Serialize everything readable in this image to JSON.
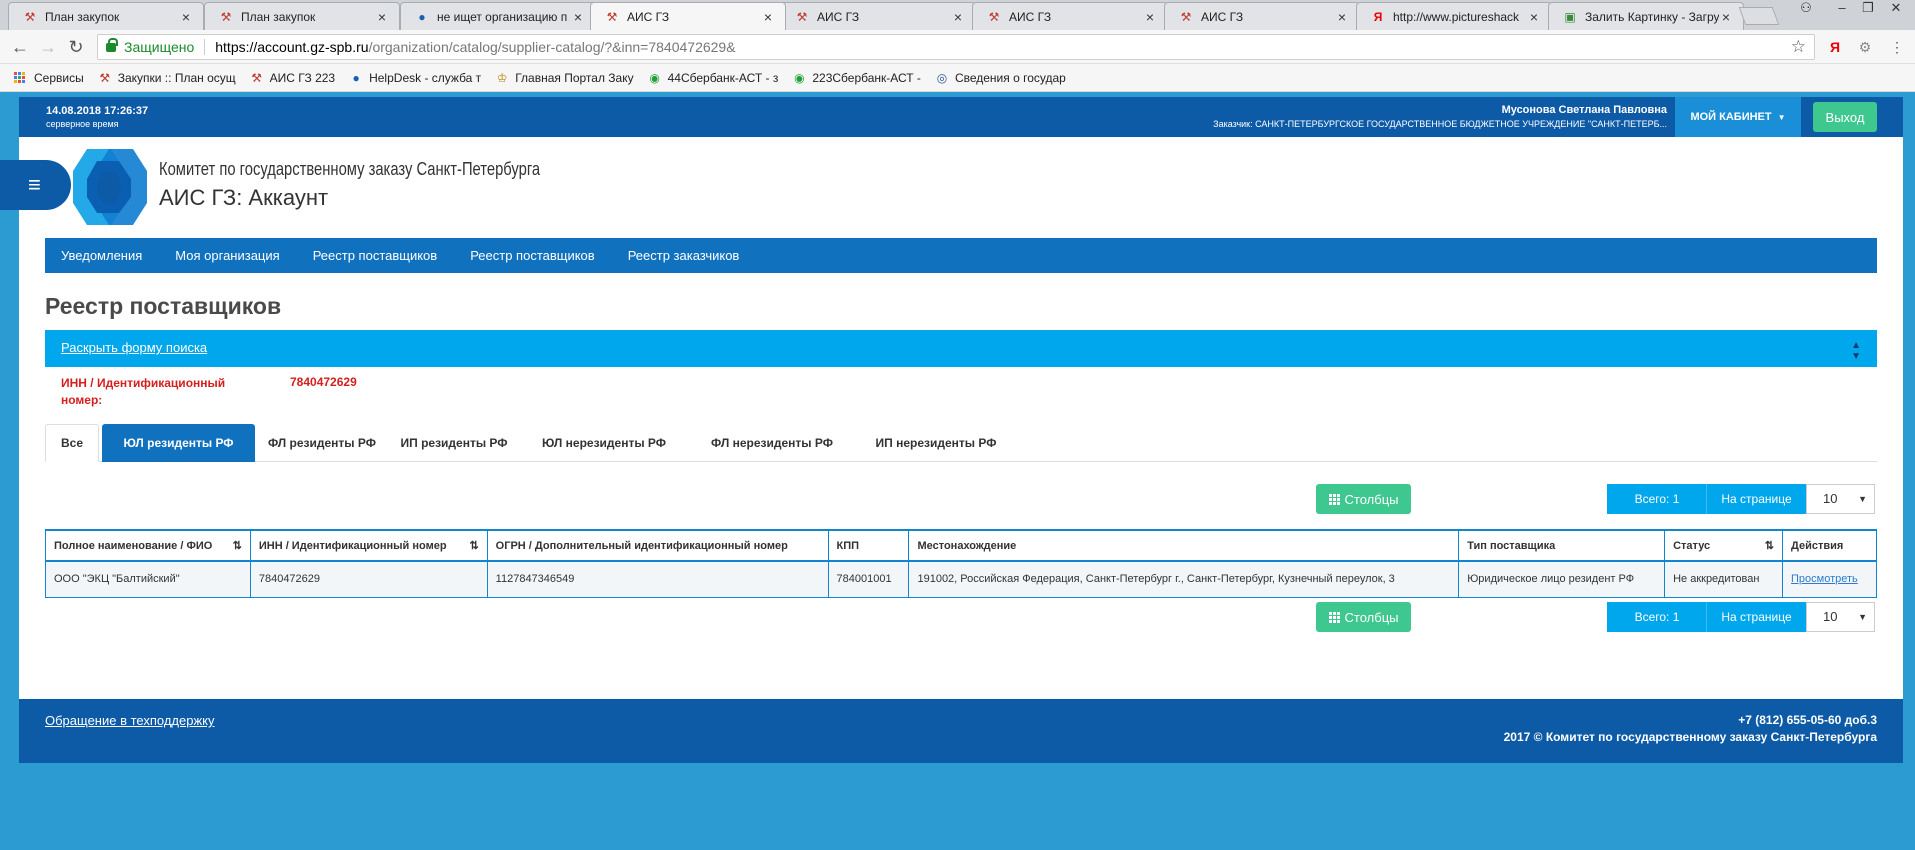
{
  "browser": {
    "tabs": [
      {
        "title": "План закупок",
        "icon": "tools-icon"
      },
      {
        "title": "План закупок",
        "icon": "tools-icon"
      },
      {
        "title": "не ищет организацию п",
        "icon": "helpdesk-icon"
      },
      {
        "title": "АИС ГЗ",
        "icon": "tools-icon"
      },
      {
        "title": "АИС ГЗ",
        "icon": "tools-icon"
      },
      {
        "title": "АИС ГЗ",
        "icon": "tools-icon"
      },
      {
        "title": "АИС ГЗ",
        "icon": "tools-icon"
      },
      {
        "title": "http://www.pictureshack",
        "icon": "yandex-icon"
      },
      {
        "title": "Залить Картинку - Загру",
        "icon": "image-icon"
      }
    ],
    "active_tab": 3,
    "address": {
      "secure_label": "Защищено",
      "url_host": "https://account.gz-spb.ru",
      "url_path": "/organization/catalog/supplier-catalog/?&inn=7840472629&"
    },
    "bookmarks": [
      {
        "label": "Сервисы",
        "icon": "apps-icon"
      },
      {
        "label": "Закупки :: План осущ",
        "icon": "tools-icon"
      },
      {
        "label": "АИС ГЗ 223",
        "icon": "tools-icon"
      },
      {
        "label": "HelpDesk - служба т",
        "icon": "helpdesk-icon"
      },
      {
        "label": "Главная Портал Заку",
        "icon": "emblem-icon"
      },
      {
        "label": "44Сбербанк-АСТ - з",
        "icon": "sberbank-icon"
      },
      {
        "label": "223Сбербанк-АСТ -",
        "icon": "sberbank-icon"
      },
      {
        "label": "Сведения о государ",
        "icon": "gov-icon"
      }
    ]
  },
  "header": {
    "server_time": "14.08.2018 17:26:37",
    "server_time_label": "серверное время",
    "user_name": "Мусонова Светлана Павловна",
    "customer": "Заказчик: САНКТ-ПЕТЕРБУРГСКОЕ ГОСУДАРСТВЕННОЕ БЮДЖЕТНОЕ УЧРЕЖДЕНИЕ \"САНКТ-ПЕТЕРБ...",
    "cabinet_label": "МОЙ КАБИНЕТ",
    "logout_label": "Выход",
    "org_title": "Комитет по государственному заказу Санкт-Петербурга",
    "app_title": "АИС ГЗ: Аккаунт"
  },
  "nav": [
    "Уведомления",
    "Моя организация",
    "Реестр поставщиков",
    "Реестр поставщиков",
    "Реестр заказчиков"
  ],
  "main": {
    "heading": "Реестр поставщиков",
    "search_toggle": "Раскрыть форму поиска",
    "filter_label": "ИНН / Идентификационный номер:",
    "filter_value": "7840472629",
    "tabs": [
      "Все",
      "ЮЛ резиденты РФ",
      "ФЛ резиденты РФ",
      "ИП резиденты РФ",
      "ЮЛ нерезиденты РФ",
      "ФЛ нерезиденты РФ",
      "ИП нерезиденты РФ"
    ],
    "selected_tab": 1,
    "columns_button": "Столбцы",
    "total_label": "Всего: 1",
    "per_page_label": "На странице",
    "per_page_value": "10",
    "table": {
      "headers": [
        "Полное наименование / ФИО",
        "ИНН / Идентификационный номер",
        "ОГРН / Дополнительный идентификационный номер",
        "КПП",
        "Местонахождение",
        "Тип поставщика",
        "Статус",
        "Действия"
      ],
      "rows": [
        [
          "ООО \"ЭКЦ \"Балтийский\"",
          "7840472629",
          "1127847346549",
          "784001001",
          "191002, Российская Федерация, Санкт-Петербург г., Санкт-Петербург, Кузнечный переулок, 3",
          "Юридическое лицо резидент РФ",
          "Не аккредитован",
          "Просмотреть"
        ]
      ]
    }
  },
  "footer": {
    "support_link": "Обращение в техподдержку",
    "phone": "+7 (812) 655-05-60 доб.3",
    "copyright": "2017 © Комитет по государственному заказу Санкт-Петербурга"
  },
  "colors": {
    "header_blue": "#0d5aa7",
    "nav_blue": "#1071bf",
    "accent_cyan": "#00a7ec",
    "green": "#3ec78f",
    "alert_red": "#d61e1e",
    "background": "#2b9bd1"
  }
}
